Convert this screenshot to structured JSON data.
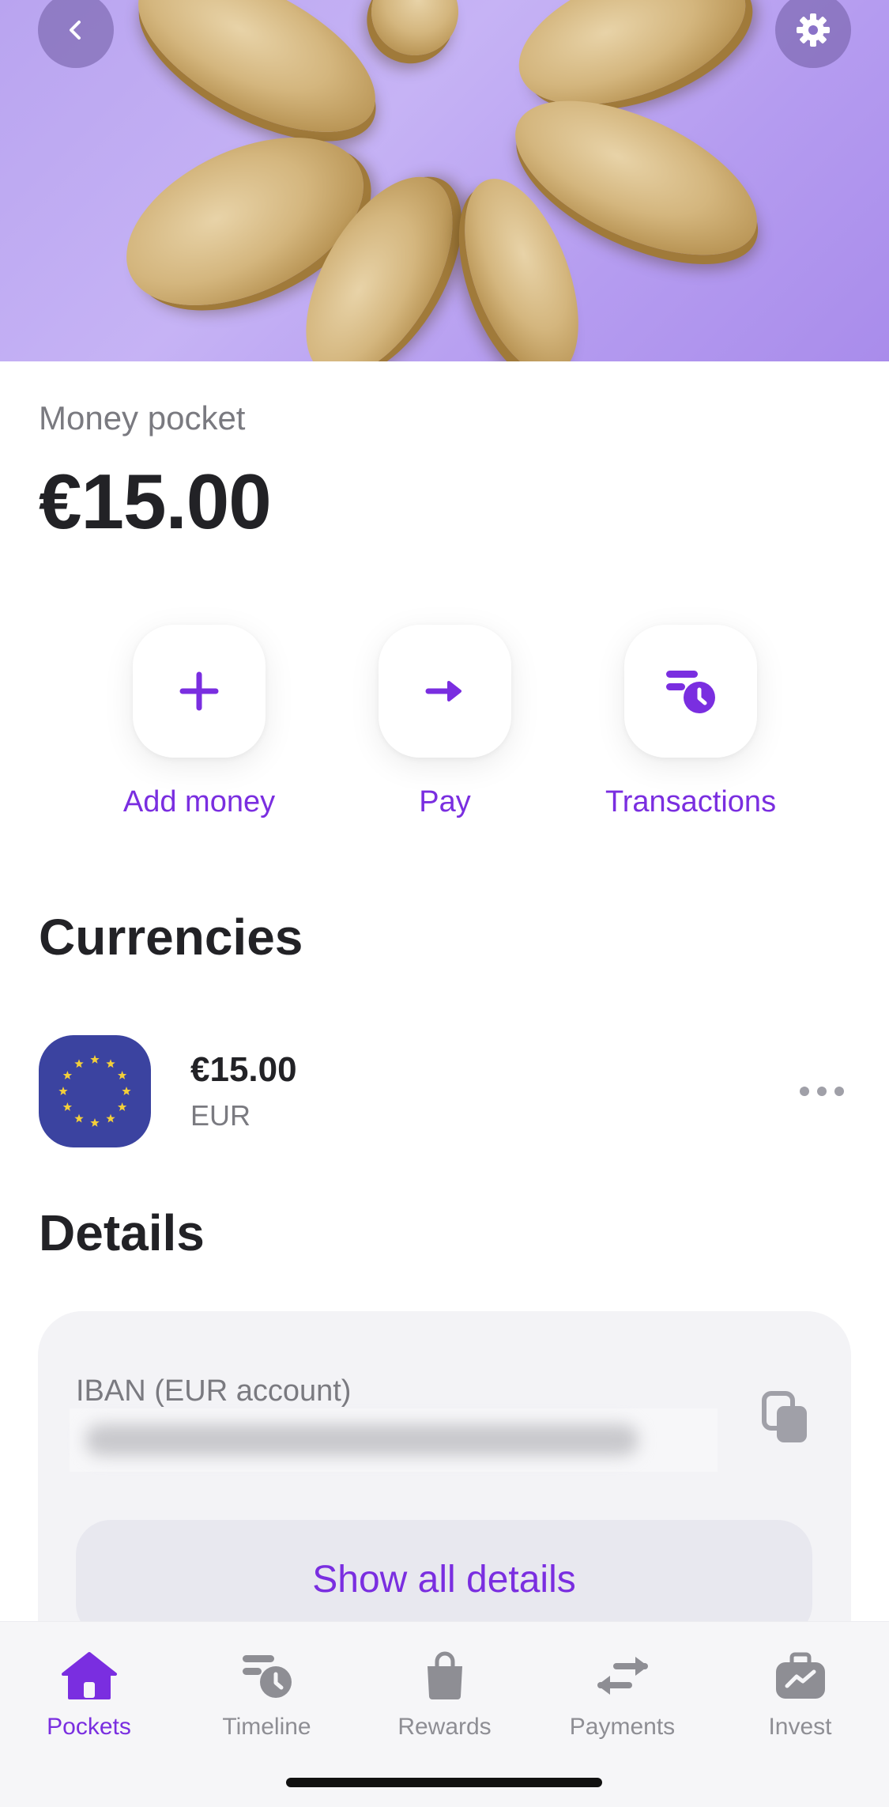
{
  "header": {
    "back_icon": "chevron-left-icon",
    "settings_icon": "gear-icon"
  },
  "pocket": {
    "label": "Money pocket",
    "balance": "€15.00"
  },
  "actions": [
    {
      "label": "Add money",
      "icon": "plus-icon"
    },
    {
      "label": "Pay",
      "icon": "arrow-right-icon"
    },
    {
      "label": "Transactions",
      "icon": "transactions-clock-icon"
    }
  ],
  "currencies": {
    "title": "Currencies",
    "items": [
      {
        "amount": "€15.00",
        "code": "EUR",
        "icon": "eu-flag-icon"
      }
    ]
  },
  "details": {
    "title": "Details",
    "iban_label": "IBAN (EUR account)",
    "show_all_label": "Show all details"
  },
  "tabbar": {
    "items": [
      {
        "label": "Pockets",
        "icon": "home-icon",
        "active": true
      },
      {
        "label": "Timeline",
        "icon": "timeline-icon",
        "active": false
      },
      {
        "label": "Rewards",
        "icon": "shopping-bag-icon",
        "active": false
      },
      {
        "label": "Payments",
        "icon": "transfer-arrows-icon",
        "active": false
      },
      {
        "label": "Invest",
        "icon": "briefcase-chart-icon",
        "active": false
      }
    ]
  },
  "colors": {
    "accent": "#7a2ee0",
    "text": "#222226",
    "muted": "#7a7a80",
    "hero": "#c6b3f5"
  }
}
